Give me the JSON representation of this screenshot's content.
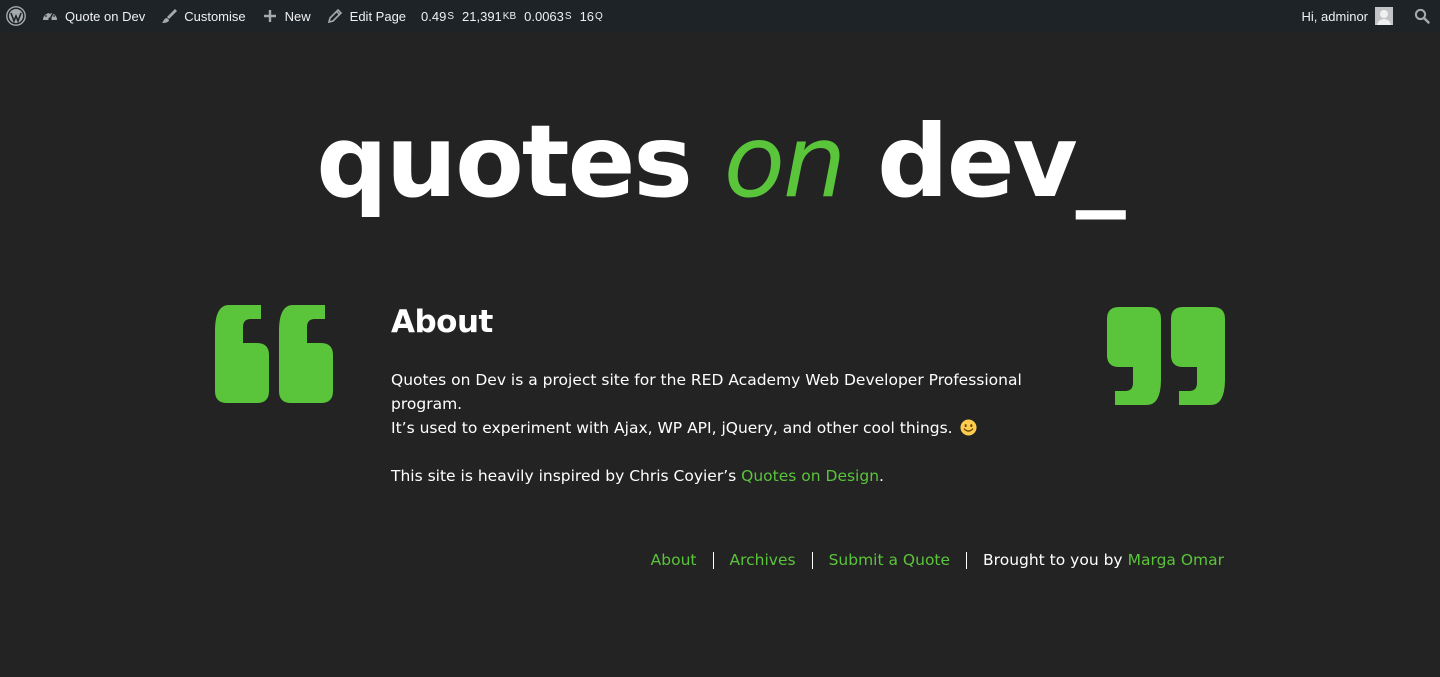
{
  "adminbar": {
    "items": [
      {
        "icon": "wordpress-logo-icon",
        "label": ""
      },
      {
        "icon": "dashboard-icon",
        "label": "Quote on Dev"
      },
      {
        "icon": "brush-icon",
        "label": "Customise"
      },
      {
        "icon": "plus-icon",
        "label": "New"
      },
      {
        "icon": "pencil-icon",
        "label": "Edit Page"
      }
    ],
    "stats": [
      {
        "value": "0.49",
        "unit": "S"
      },
      {
        "value": "21,391",
        "unit": "KB"
      },
      {
        "value": "0.0063",
        "unit": "S"
      },
      {
        "value": "16",
        "unit": "Q"
      }
    ],
    "greeting": "Hi, adminor",
    "search_icon": "search-icon"
  },
  "logo": {
    "part1": "quotes ",
    "part2": "on",
    "part3": " dev_"
  },
  "content": {
    "title": "About",
    "para1_line1": "Quotes on Dev is a project site for the RED Academy Web Developer Professional program.",
    "para1_line2": "It’s used to experiment with Ajax, WP API, jQuery, and other cool things.",
    "para2_prefix": "This site is heavily inspired by Chris Coyier’s ",
    "para2_link": "Quotes on Design",
    "para2_suffix": "."
  },
  "footer": {
    "links": [
      "About",
      "Archives",
      "Submit a Quote"
    ],
    "credit_prefix": "Brought to you by",
    "credit_name": "Marga Omar"
  },
  "colors": {
    "background": "#232323",
    "accent": "#5ac43b",
    "adminbar": "#1d2327"
  }
}
